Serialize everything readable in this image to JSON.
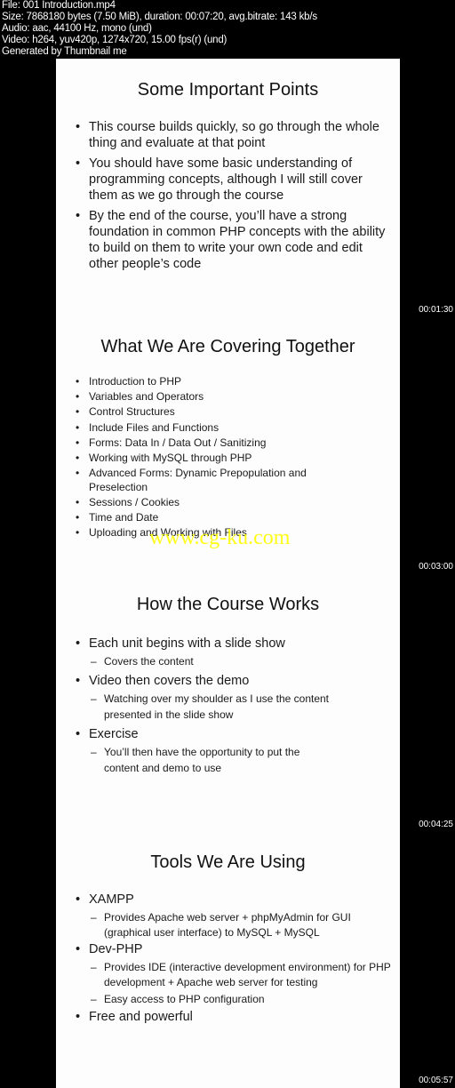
{
  "header": {
    "file": "File: 001 Introduction.mp4",
    "size": "Size: 7868180 bytes (7.50 MiB), duration: 00:07:20, avg.bitrate: 143 kb/s",
    "audio": "Audio: aac, 44100 Hz, mono (und)",
    "video": "Video: h264, yuv420p, 1274x720, 15.00 fps(r) (und)",
    "generator": "Generated by Thumbnail me"
  },
  "slides": [
    {
      "title": "Some Important Points",
      "timestamp": "00:01:30",
      "bullets": [
        "This course builds quickly, so go through the whole thing and evaluate at that point",
        " You should have some basic understanding of programming concepts, although I will still cover them as we go through the course",
        "By the end of the course, you’ll have a strong foundation in common PHP concepts with the ability to build on them to write your own code and edit other people’s code"
      ]
    },
    {
      "title": "What We Are Covering Together",
      "timestamp": "00:03:00",
      "bullets": [
        "Introduction to PHP",
        "Variables and Operators",
        "Control Structures",
        "Include Files and Functions",
        "Forms: Data In / Data Out / Sanitizing",
        "Working with MySQL through PHP",
        "Advanced Forms: Dynamic Prepopulation and Preselection",
        "Sessions / Cookies",
        "Time and Date",
        "Uploading and Working with Files"
      ]
    },
    {
      "title": "How the Course Works",
      "timestamp": "00:04:25",
      "bullets": [
        {
          "text": "Each unit begins with a slide show",
          "sub": [
            "Covers the content"
          ]
        },
        {
          "text": "Video then covers the demo",
          "sub": [
            "Watching over my shoulder as I use the content presented in the slide show"
          ]
        },
        {
          "text": "Exercise",
          "sub": [
            "You’ll then have the opportunity to put the content and demo to use"
          ]
        }
      ]
    },
    {
      "title": "Tools We Are Using",
      "timestamp": "00:05:57",
      "bullets": [
        {
          "text": "XAMPP",
          "sub": [
            "Provides Apache web server + phpMyAdmin for GUI (graphical user interface) to MySQL  + MySQL"
          ]
        },
        {
          "text": "Dev-PHP",
          "sub": [
            "Provides IDE (interactive development environment) for PHP development + Apache web server for testing",
            "Easy access to PHP configuration"
          ]
        },
        {
          "text": "Free and powerful",
          "sub": []
        }
      ]
    }
  ],
  "watermark": "www.cg-ku.com",
  "colors": {
    "background": "#000000",
    "slide": "#fdfdfd",
    "watermark": "#ffff00"
  }
}
